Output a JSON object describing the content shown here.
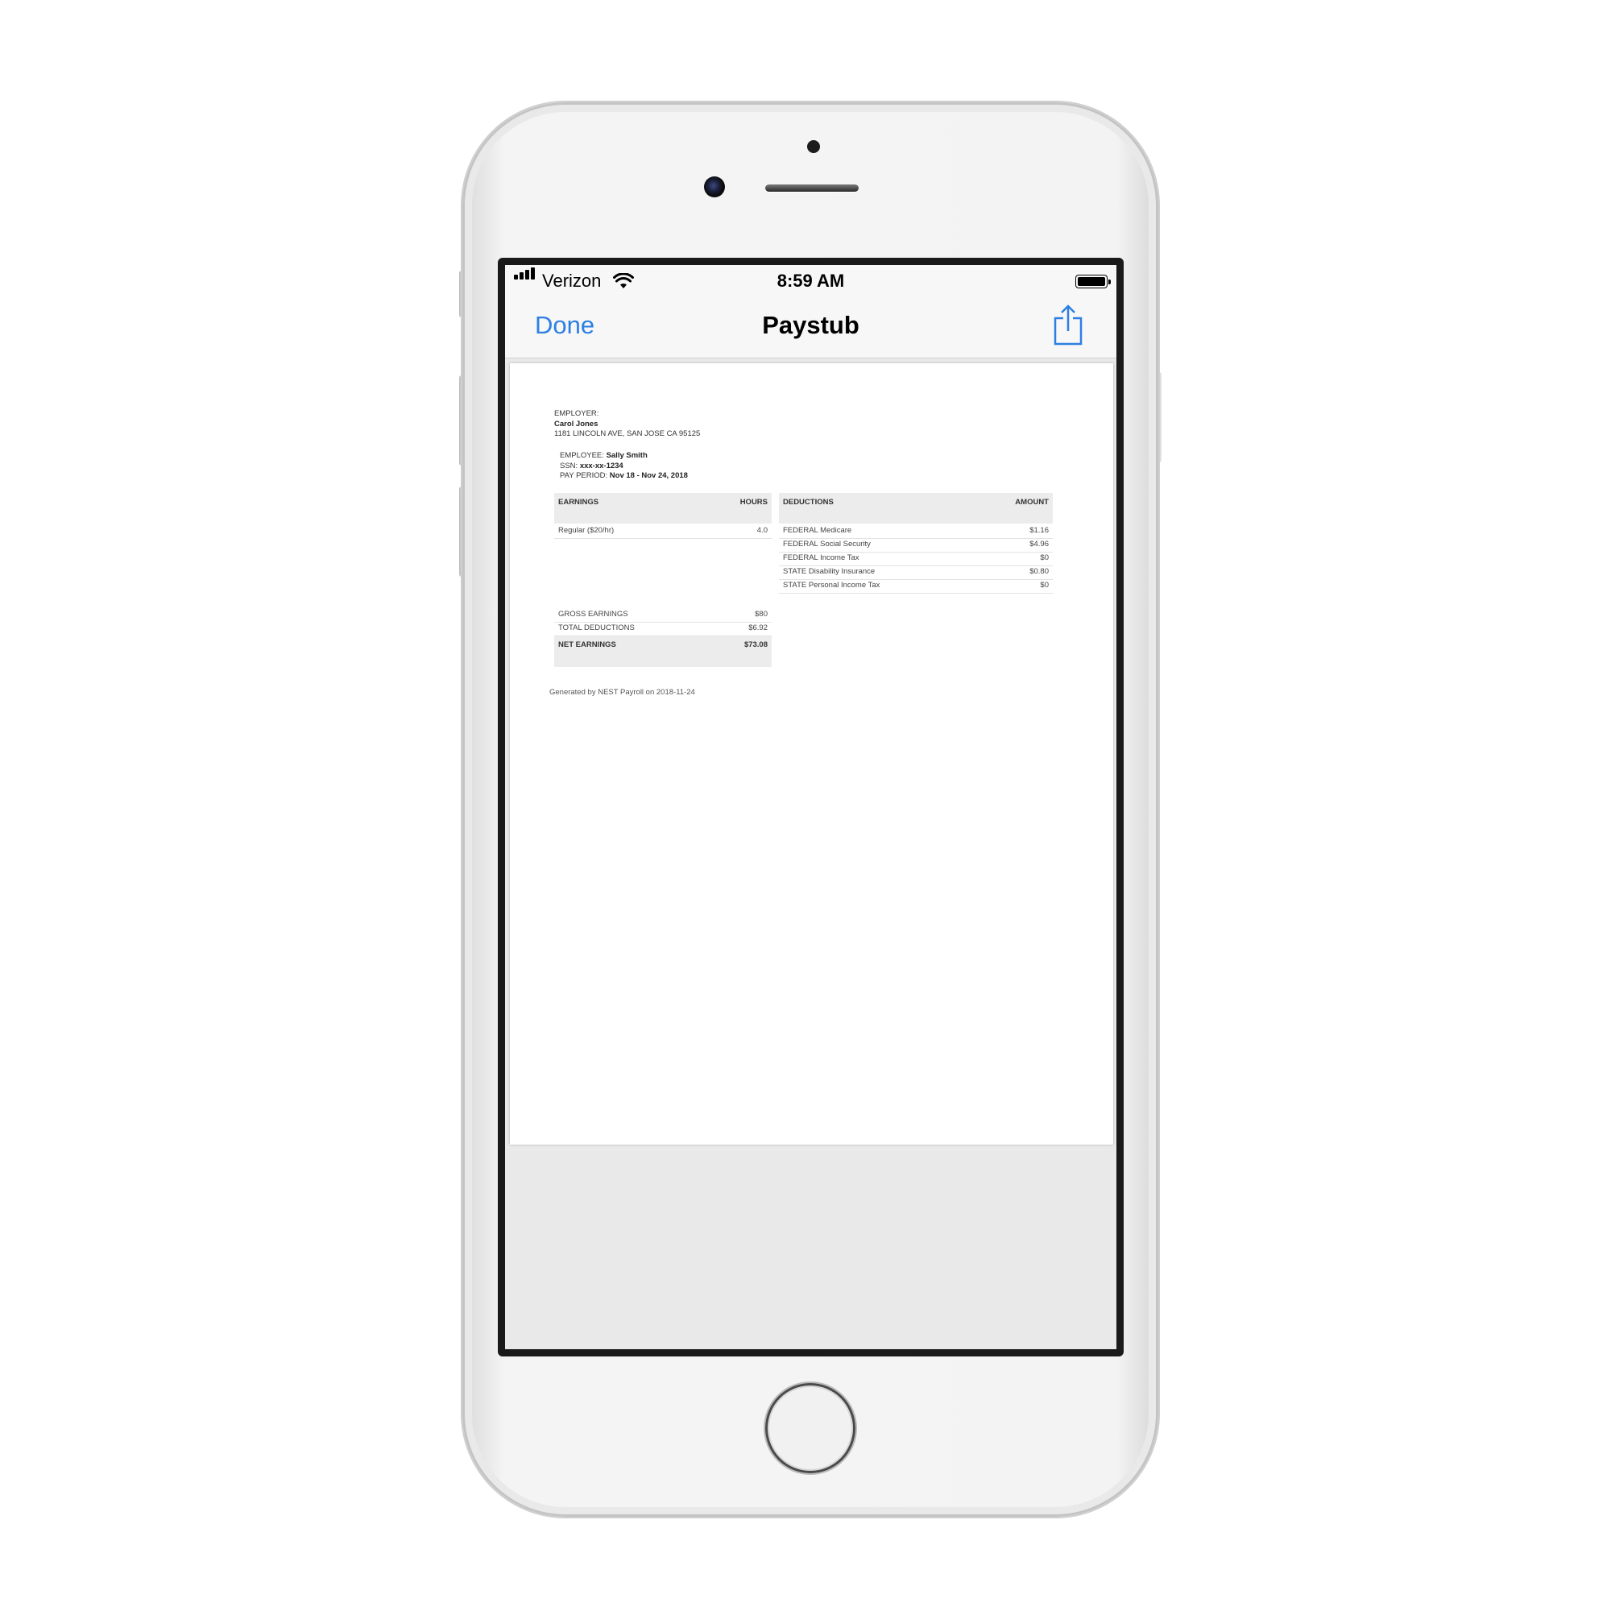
{
  "status_bar": {
    "carrier": "Verizon",
    "time": "8:59 AM"
  },
  "nav": {
    "done_label": "Done",
    "title": "Paystub",
    "share_icon": "share-icon",
    "accent_color": "#2d7fe3"
  },
  "document": {
    "employer_label": "EMPLOYER:",
    "employer_name": "Carol Jones",
    "employer_address": "1181 LINCOLN AVE, SAN JOSE CA 95125",
    "employee_label": "EMPLOYEE:",
    "employee_name": "Sally Smith",
    "ssn_label": "SSN:",
    "ssn": "xxx-xx-1234",
    "pay_period_label": "PAY PERIOD:",
    "pay_period": "Nov 18 - Nov 24, 2018",
    "earnings": {
      "headers": [
        "EARNINGS",
        "HOURS"
      ],
      "rows": [
        {
          "label": "Regular ($20/hr)",
          "value": "4.0"
        }
      ]
    },
    "deductions": {
      "headers": [
        "DEDUCTIONS",
        "AMOUNT"
      ],
      "rows": [
        {
          "label": "FEDERAL Medicare",
          "value": "$1.16"
        },
        {
          "label": "FEDERAL Social Security",
          "value": "$4.96"
        },
        {
          "label": "FEDERAL Income Tax",
          "value": "$0"
        },
        {
          "label": "STATE Disability Insurance",
          "value": "$0.80"
        },
        {
          "label": "STATE Personal Income Tax",
          "value": "$0"
        }
      ]
    },
    "totals": {
      "gross_label": "GROSS EARNINGS",
      "gross_value": "$80",
      "deductions_label": "TOTAL DEDUCTIONS",
      "deductions_value": "$6.92",
      "net_label": "NET EARNINGS",
      "net_value": "$73.08"
    },
    "footer": "Generated by NEST Payroll on 2018-11-24"
  }
}
